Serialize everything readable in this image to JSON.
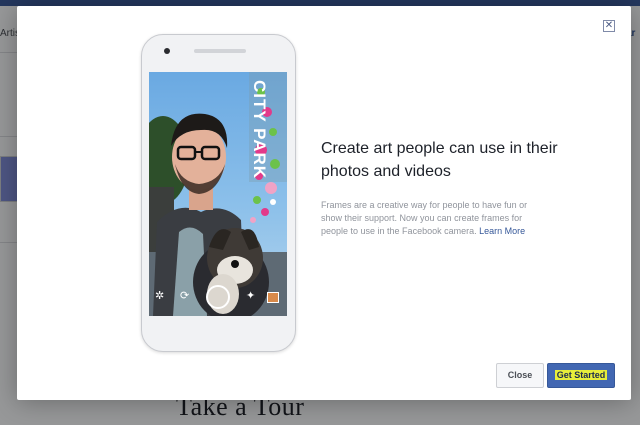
{
  "background": {
    "left_text": "Artist",
    "right_text": "ar",
    "heading": "Take a Tour"
  },
  "dialog": {
    "close_icon": "close-x-icon",
    "title": "Create art people can use in their photos and videos",
    "description": "Frames are a creative way for people to have fun or show their support. Now you can create frames for people to use in the Facebook camera.",
    "learn_more": "Learn More",
    "phone_frame_text": "CITY PARK",
    "buttons": {
      "close": "Close",
      "get_started": "Get Started"
    }
  },
  "colors": {
    "primary_button": "#4267b2",
    "link": "#365899",
    "highlight": "#e8ee3a"
  },
  "icons": [
    "settings-icon",
    "switch-camera-icon",
    "shutter-button-icon",
    "effects-icon",
    "gallery-icon"
  ]
}
